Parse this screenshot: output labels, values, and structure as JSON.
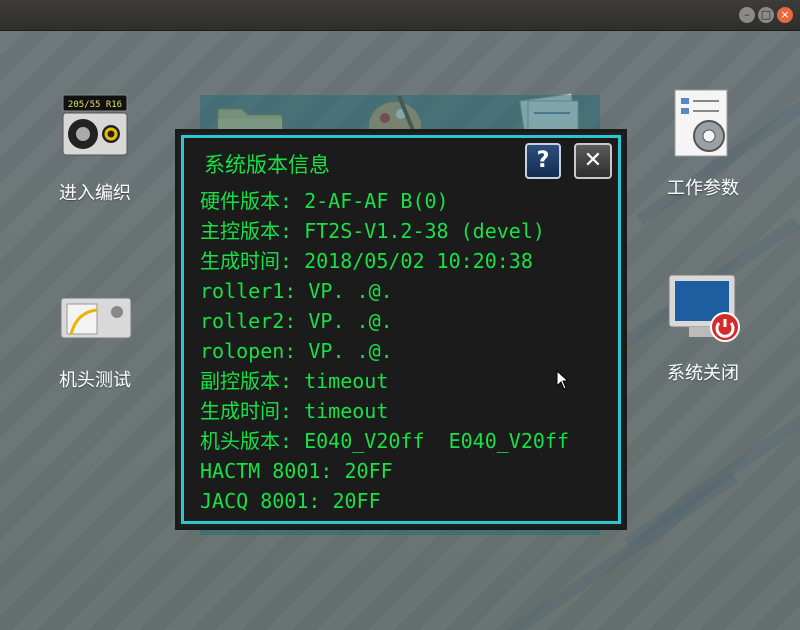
{
  "window": {
    "buttons": {
      "minimize": "–",
      "maximize": "□",
      "close": "×"
    }
  },
  "desktop": {
    "apps": [
      {
        "id": "enter-knit",
        "label": "进入编织",
        "icon": "knitting-machine-icon"
      },
      {
        "id": "folder",
        "label": "",
        "icon": "folder-icon"
      },
      {
        "id": "paint",
        "label": "",
        "icon": "paint-palette-icon"
      },
      {
        "id": "documents",
        "label": "",
        "icon": "documents-icon"
      },
      {
        "id": "work-params",
        "label": "工作参数",
        "icon": "settings-gear-icon"
      },
      {
        "id": "head-test",
        "label": "机头测试",
        "icon": "machine-head-icon"
      },
      {
        "id": "system-shutdown",
        "label": "系统关闭",
        "icon": "power-monitor-icon"
      }
    ]
  },
  "dialog": {
    "title": "系统版本信息",
    "help_label": "?",
    "close_label": "✕",
    "lines": [
      "硬件版本: 2-AF-AF B(0)",
      "主控版本: FT2S-V1.2-38 (devel)",
      "生成时间: 2018/05/02 10:20:38",
      "roller1: VP. .@.",
      "roller2: VP. .@.",
      "rolopen: VP. .@.",
      "副控版本: timeout",
      "生成时间: timeout",
      "机头版本: E040_V20ff  E040_V20ff",
      "HACTM 8001: 20FF",
      "JACQ 8001: 20FF"
    ]
  },
  "colors": {
    "dialog_text": "#19e046",
    "dialog_border": "#2ec5d0",
    "desktop_bg": "#6a7578"
  }
}
